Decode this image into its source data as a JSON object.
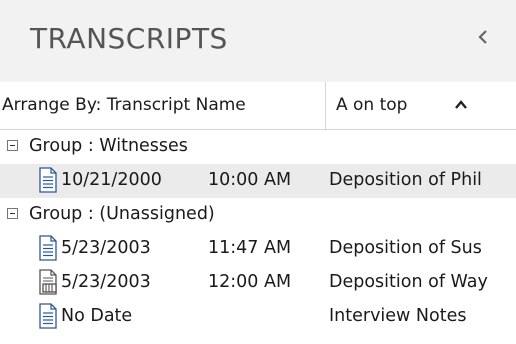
{
  "pane": {
    "title": "TRANSCRIPTS",
    "collapse_icon": "chevron-left-icon"
  },
  "columns": {
    "arrange_label": "Arrange By: Transcript Name",
    "sort_label": "A on top",
    "sort_icon": "chevron-up-icon"
  },
  "groups": [
    {
      "label": "Group : Witnesses",
      "items": [
        {
          "date": "10/21/2000",
          "time": "10:00 AM",
          "name": "Deposition of Phil",
          "icon": "document-icon",
          "selected": true
        }
      ]
    },
    {
      "label": "Group : (Unassigned)",
      "items": [
        {
          "date": "5/23/2003",
          "time": "11:47 AM",
          "name": "Deposition of Sus",
          "icon": "document-icon",
          "selected": false
        },
        {
          "date": "5/23/2003",
          "time": "12:00 AM",
          "name": "Deposition of Way",
          "icon": "video-document-icon",
          "selected": false
        },
        {
          "date": "No Date",
          "time": "",
          "name": "Interview Notes",
          "icon": "document-icon",
          "selected": false
        }
      ]
    }
  ],
  "colors": {
    "header_bg": "#f2f2f2",
    "selected_bg": "#ebebeb",
    "icon_blue": "#2b5797"
  }
}
